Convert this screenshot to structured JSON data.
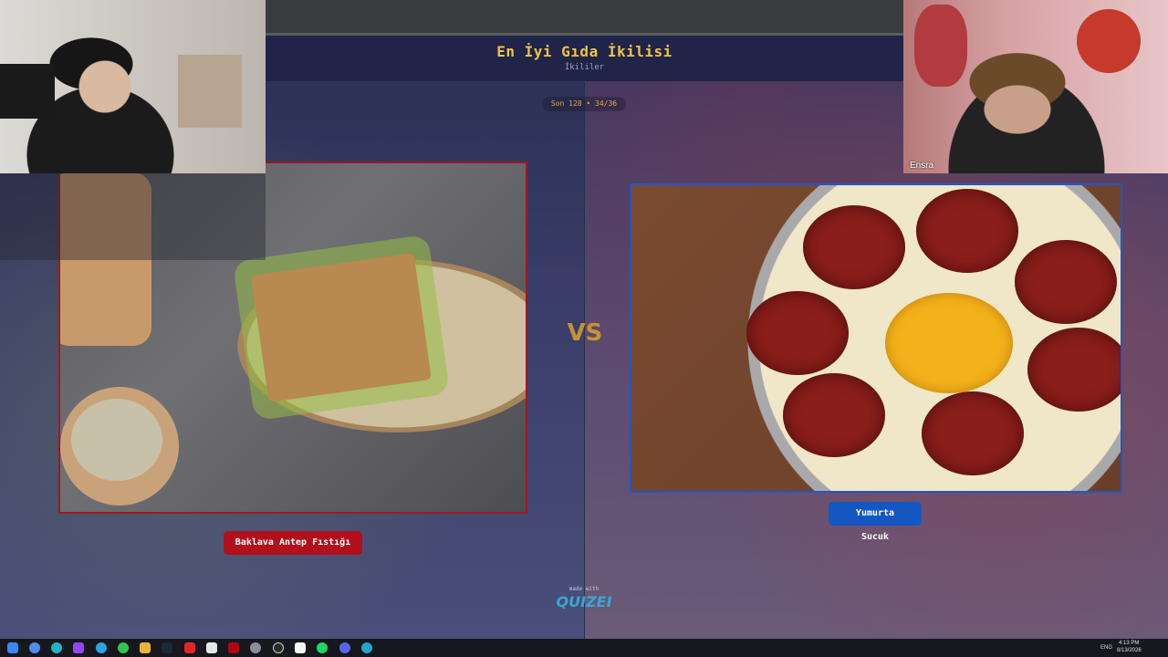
{
  "quiz": {
    "title": "En İyi Gıda İkilisi",
    "subtitle": "İkililer",
    "progress": "Son 128 • 34/36"
  },
  "matchup": {
    "left": {
      "label": "Baklava Antep Fıstığı",
      "accent": "#b10f1b"
    },
    "right": {
      "label": "Yumurta Sucuk",
      "accent": "#1457c2"
    },
    "vs_text": "VS"
  },
  "footer": {
    "made_with": "made with",
    "brand": "QUIZEI"
  },
  "webcams": {
    "right_name": "Ensra"
  },
  "taskbar": {
    "icons": [
      "windows-start-icon",
      "chrome-icon",
      "edge-icon",
      "twitch-icon",
      "telegram-icon",
      "whatsapp-icon",
      "file-explorer-icon",
      "steam-icon",
      "adobe-icon",
      "notion-icon",
      "netflix-icon",
      "settings-icon",
      "obs-icon",
      "capcut-icon",
      "spotify-icon",
      "discord-icon",
      "browser-icon"
    ],
    "language": "ENG",
    "time": "4:13 PM",
    "date": "8/13/2026"
  }
}
